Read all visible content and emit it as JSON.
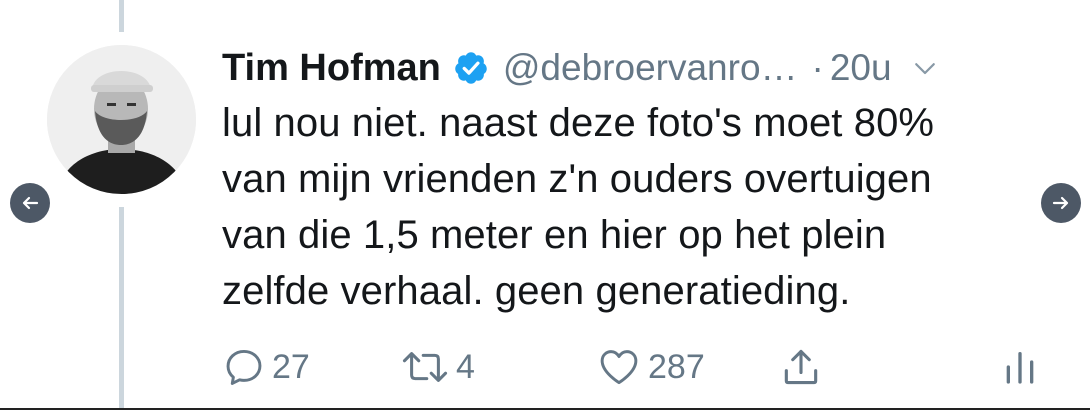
{
  "tweet": {
    "author_name": "Tim Hofman",
    "handle": "@debroervanro…",
    "separator": "·",
    "time": "20u",
    "text_lines": [
      "lul nou niet. naast deze foto's moet 80%",
      "van mijn vrienden z'n ouders overtuigen",
      "van die 1,5 meter en hier op het plein",
      "zelfde verhaal. geen generatieding."
    ],
    "replies": "27",
    "retweets": "4",
    "likes": "287"
  },
  "icons": {
    "verified": "verified-badge-icon",
    "caret": "chevron-down-icon",
    "reply": "reply-icon",
    "retweet": "retweet-icon",
    "like": "heart-icon",
    "share": "share-icon",
    "stats": "analytics-icon",
    "prev": "arrow-left-icon",
    "next": "arrow-right-icon"
  },
  "colors": {
    "verified_blue": "#1da1f2",
    "secondary_text": "#657786",
    "nav_button": "#4d5866",
    "thread_line": "#ccd6dd"
  }
}
